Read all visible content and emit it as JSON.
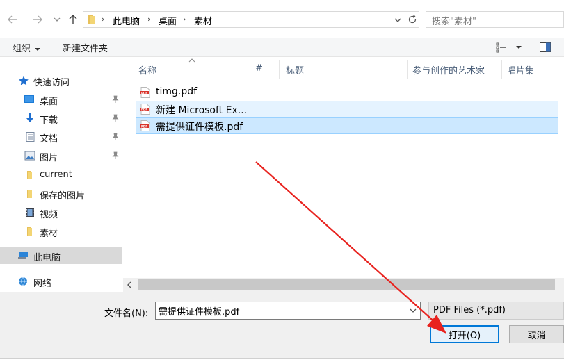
{
  "address": {
    "crumbs": [
      "此电脑",
      "桌面",
      "素材"
    ]
  },
  "search": {
    "placeholder": "搜索\"素材\""
  },
  "commands": {
    "organize": "组织",
    "new_folder": "新建文件夹"
  },
  "nav": {
    "quick_access": "快速访问",
    "items": [
      "桌面",
      "下载",
      "文档",
      "图片",
      "current",
      "保存的图片",
      "视频",
      "素材"
    ],
    "this_pc": "此电脑",
    "network": "网络"
  },
  "columns": {
    "name": "名称",
    "number": "#",
    "title": "标题",
    "contributing_artists": "参与创作的艺术家",
    "album": "唱片集"
  },
  "files": [
    {
      "name": "timg.pdf"
    },
    {
      "name": "新建 Microsoft Ex..."
    },
    {
      "name": "需提供证件模板.pdf"
    }
  ],
  "footer": {
    "filename_label": "文件名(N):",
    "filename_value": "需提供证件模板.pdf",
    "filetype": "PDF Files (*.pdf)",
    "open_label": "打开(O)",
    "cancel_label": "取消"
  },
  "colors": {
    "accent": "#0078d7",
    "selected_row": "#cce8ff",
    "hover_row": "#e5f3ff",
    "annotation": "#e8231f"
  },
  "icons": [
    "back-arrow-icon",
    "forward-arrow-icon",
    "history-dropdown-icon",
    "up-arrow-icon",
    "folder-icon",
    "refresh-icon",
    "star-icon",
    "desktop-icon",
    "download-icon",
    "document-icon",
    "picture-icon",
    "video-icon",
    "computer-icon",
    "network-icon",
    "pin-icon",
    "pdf-icon",
    "view-options-icon",
    "preview-pane-icon"
  ]
}
